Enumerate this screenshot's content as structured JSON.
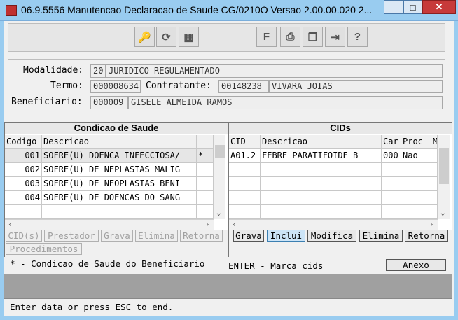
{
  "window": {
    "title": "06.9.5556 Manutencao  Declaracao de Saude CG/0210O Versao 2.00.00.020 2...",
    "minimize": "—",
    "maximize": "□",
    "close": "✕"
  },
  "toolbar": {
    "icons": [
      "search-key-icon",
      "refresh-docs-icon",
      "grid-config-icon",
      "form-icon",
      "print-icon",
      "copy-icon",
      "exit-icon",
      "help-icon"
    ],
    "glyphs": [
      "🔑",
      "⟳",
      "▦",
      "F",
      "⎙",
      "❐",
      "⇥",
      "?"
    ]
  },
  "header": {
    "modalidade_label": "Modalidade:",
    "modalidade_code": "20",
    "modalidade_desc": "JURIDICO REGULAMENTADO",
    "termo_label": "Termo:",
    "termo_value": "000008634",
    "contratante_label": "Contratante:",
    "contratante_code": "00148238",
    "contratante_name": "VIVARA JOIAS",
    "beneficiario_label": "Beneficiario:",
    "beneficiario_code": "000009",
    "beneficiario_name": "GISELE ALMEIDA RAMOS"
  },
  "condicao": {
    "title": "Condicao de Saude",
    "col_codigo": "Codigo",
    "col_descricao": "Descricao",
    "rows": [
      {
        "codigo": "001",
        "descricao": "SOFRE(U) DOENCA INFECCIOSA/",
        "flag": "*"
      },
      {
        "codigo": "002",
        "descricao": "SOFRE(U) DE NEPLASIAS MALIG",
        "flag": ""
      },
      {
        "codigo": "003",
        "descricao": "SOFRE(U) DE NEOPLASIAS BENI",
        "flag": ""
      },
      {
        "codigo": "004",
        "descricao": "SOFRE(U) DE DOENCAS DO SANG",
        "flag": ""
      }
    ],
    "buttons": {
      "cids": "CID(s)",
      "prestador": "Prestador",
      "grava": "Grava",
      "elimina": "Elimina",
      "retorna": "Retorna",
      "procedimentos": "Procedimentos"
    },
    "footnote": "* - Condicao de Saude do Beneficiario"
  },
  "cids": {
    "title": "CIDs",
    "col_cid": "CID",
    "col_descricao": "Descricao",
    "col_car": "Car",
    "col_proc": "Proc",
    "col_m": "M",
    "rows": [
      {
        "cid": "A01.2",
        "descricao": "FEBRE PARATIFOIDE B",
        "car": "000",
        "proc": "Nao"
      }
    ],
    "buttons": {
      "grava": "Grava",
      "inclui": "Inclui",
      "modifica": "Modifica",
      "elimina": "Elimina",
      "retorna": "Retorna"
    },
    "hint": "ENTER - Marca cids",
    "anexo": "Anexo"
  },
  "status": {
    "message": "Enter data or press ESC to end."
  }
}
